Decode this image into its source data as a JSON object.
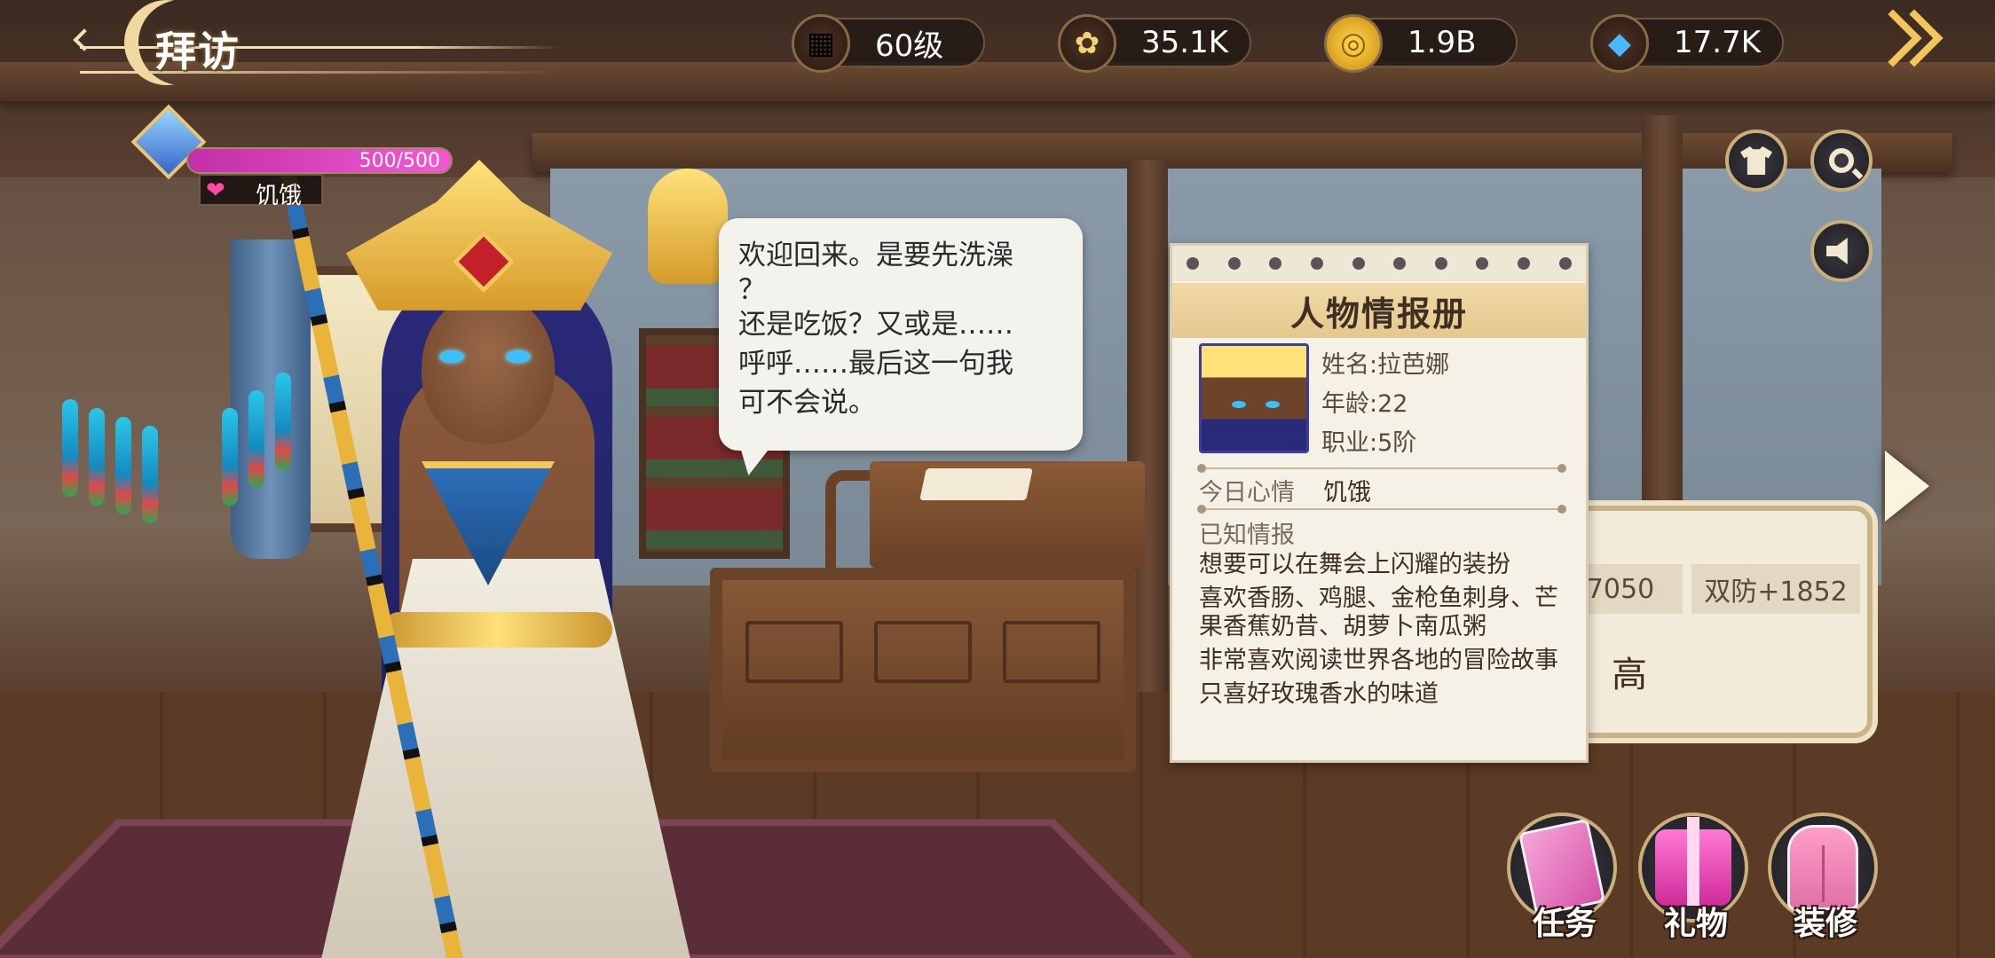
{
  "header": {
    "title": "拜访"
  },
  "resources": [
    {
      "name": "level",
      "icon": "treasure-chest-icon",
      "value": "60级"
    },
    {
      "name": "food",
      "icon": "grain-sack-icon",
      "value": "35.1K"
    },
    {
      "name": "gold",
      "icon": "gold-coin-icon",
      "value": "1.9B"
    },
    {
      "name": "diamond",
      "icon": "diamond-icon",
      "value": "17.7K"
    }
  ],
  "status": {
    "hp_text": "500/500",
    "hp_fraction": 1.0,
    "mood": "饥饿"
  },
  "dialogue": {
    "lines": [
      "欢迎回来。是要先洗澡",
      "？",
      "还是吃饭？又或是……",
      "呼呼……最后这一句我",
      "可不会说。"
    ]
  },
  "info_card": {
    "title": "人物情报册",
    "name_field": "姓名:拉芭娜",
    "age_field": "年龄:22",
    "job_field": "职业:5阶",
    "mood_label": "今日心情",
    "mood_value": "饥饿",
    "known_label": "已知情报",
    "known": [
      "想要可以在舞会上闪耀的装扮",
      "喜欢香肠、鸡腿、金枪鱼刺身、芒",
      "果香蕉奶昔、胡萝卜南瓜粥",
      "非常喜欢阅读世界各地的冒险故事",
      "只喜好玫瑰香水的味道"
    ]
  },
  "stats_panel": {
    "chip1": "7050",
    "chip2": "双防+1852",
    "rarity": "高"
  },
  "bottom_buttons": [
    {
      "label": "任务",
      "icon": "quest-book-icon"
    },
    {
      "label": "礼物",
      "icon": "gift-box-icon"
    },
    {
      "label": "装修",
      "icon": "wardrobe-icon"
    }
  ],
  "side_buttons": [
    {
      "icon": "outfit-shirt-icon"
    },
    {
      "icon": "search-icon"
    },
    {
      "icon": "speaker-icon"
    }
  ]
}
